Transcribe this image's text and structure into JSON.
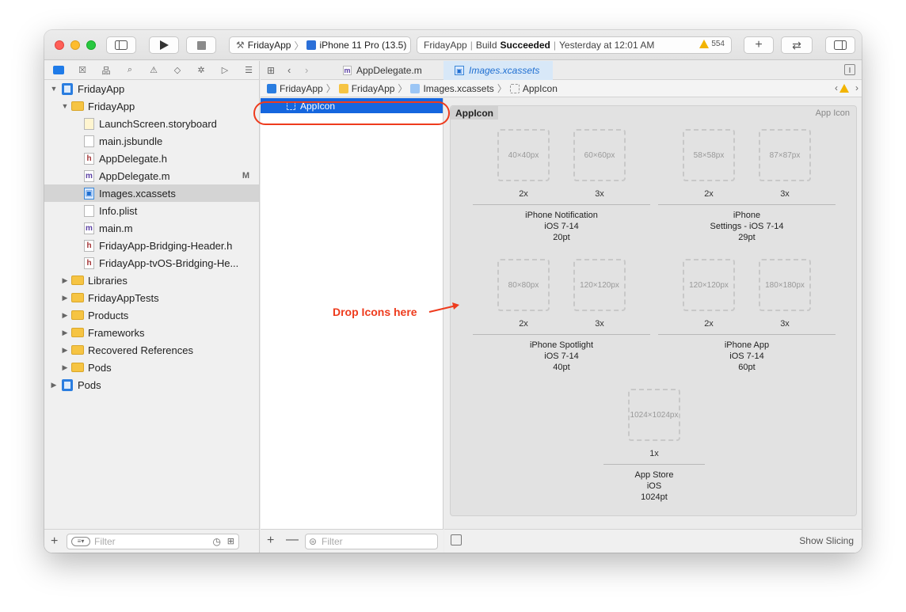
{
  "toolbar": {
    "scheme_name": "FridayApp",
    "device_name": "iPhone 11 Pro (13.5)",
    "status_app": "FridayApp",
    "status_build_label": "Build",
    "status_build_result": "Succeeded",
    "status_time": "Yesterday at 12:01 AM",
    "warning_count": "554",
    "add_label": "+",
    "swap_label": "⇄"
  },
  "navigator": {
    "project_root": "FridayApp",
    "group_main": "FridayApp",
    "files": [
      {
        "name": "LaunchScreen.storyboard",
        "kind": "sb"
      },
      {
        "name": "main.jsbundle",
        "kind": "plain"
      },
      {
        "name": "AppDelegate.h",
        "kind": "h"
      },
      {
        "name": "AppDelegate.m",
        "kind": "m",
        "badge": "M"
      },
      {
        "name": "Images.xcassets",
        "kind": "xc"
      },
      {
        "name": "Info.plist",
        "kind": "plain"
      },
      {
        "name": "main.m",
        "kind": "m"
      },
      {
        "name": "FridayApp-Bridging-Header.h",
        "kind": "h"
      },
      {
        "name": "FridayApp-tvOS-Bridging-He...",
        "kind": "h"
      }
    ],
    "groups": [
      "Libraries",
      "FridayAppTests",
      "Products",
      "Frameworks",
      "Recovered References",
      "Pods"
    ],
    "pods_project": "Pods",
    "filter_placeholder": "Filter"
  },
  "tabs": {
    "tab1": "AppDelegate.m",
    "tab2": "Images.xcassets"
  },
  "jumpbar": {
    "crumb1": "FridayApp",
    "crumb2": "FridayApp",
    "crumb3": "Images.xcassets",
    "crumb4": "AppIcon"
  },
  "asset_list": {
    "selected_item": "AppIcon",
    "filter_placeholder": "Filter"
  },
  "detail": {
    "panel_title": "AppIcon",
    "panel_kind": "App Icon",
    "groups": [
      {
        "slot1": "40×40px",
        "slot2": "60×60px",
        "scale1": "2x",
        "scale2": "3x",
        "line1": "iPhone Notification",
        "line2": "iOS 7-14",
        "line3": "20pt"
      },
      {
        "slot1": "58×58px",
        "slot2": "87×87px",
        "scale1": "2x",
        "scale2": "3x",
        "line1": "iPhone",
        "line2": "Settings - iOS 7-14",
        "line3": "29pt"
      },
      {
        "slot1": "80×80px",
        "slot2": "120×120px",
        "scale1": "2x",
        "scale2": "3x",
        "line1": "iPhone Spotlight",
        "line2": "iOS 7-14",
        "line3": "40pt"
      },
      {
        "slot1": "120×120px",
        "slot2": "180×180px",
        "scale1": "2x",
        "scale2": "3x",
        "line1": "iPhone App",
        "line2": "iOS 7-14",
        "line3": "60pt"
      }
    ],
    "store": {
      "slot": "1024×1024px",
      "scale": "1x",
      "line1": "App Store",
      "line2": "iOS",
      "line3": "1024pt"
    },
    "show_slicing": "Show Slicing"
  },
  "annotation": {
    "drop_text": "Drop Icons here",
    "accent_color": "#ee3b1d"
  }
}
